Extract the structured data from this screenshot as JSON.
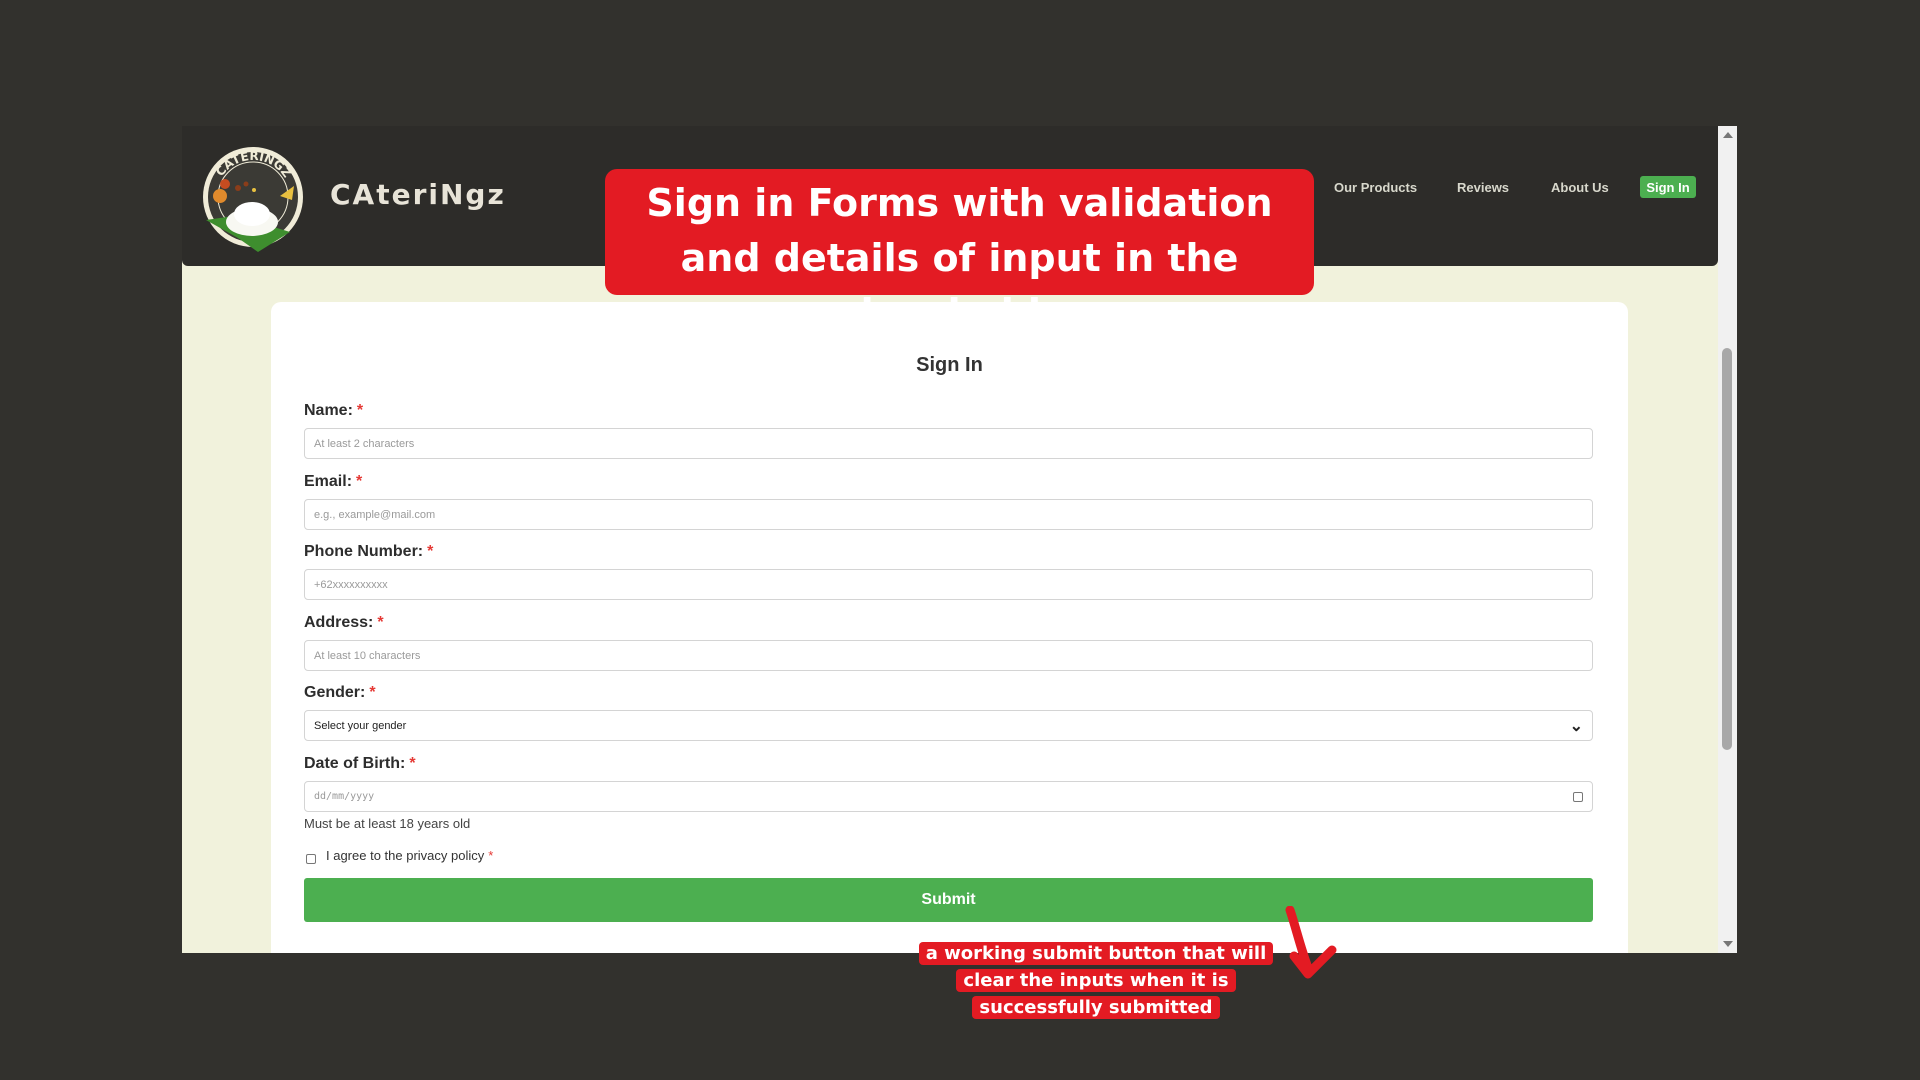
{
  "nav": {
    "brand": "CAteriNgz",
    "logo_text": "CATERINGZ",
    "links": [
      "Our Products",
      "Reviews",
      "About Us"
    ],
    "signin": "Sign In"
  },
  "form": {
    "title": "Sign In",
    "fields": [
      {
        "label": "Name:",
        "placeholder": "At least 2 characters"
      },
      {
        "label": "Email:",
        "placeholder": "e.g., example@mail.com"
      },
      {
        "label": "Phone Number:",
        "placeholder": "+62xxxxxxxxxx"
      },
      {
        "label": "Address:",
        "placeholder": "At least 10 characters"
      },
      {
        "label": "Gender:",
        "selected": "Select your gender"
      },
      {
        "label": "Date of Birth:",
        "placeholder": "dd/mm/yyyy",
        "hint": "Must be at least 18 years old"
      }
    ],
    "required_mark": "*",
    "privacy_label": "I agree to the privacy policy",
    "submit": "Submit"
  },
  "annotations": {
    "title": "Sign in Forms with validation and details of input in the placeholder",
    "note": "a working submit button that will clear the inputs when it is successfully submitted"
  },
  "colors": {
    "accent": "#4caf50",
    "callout": "#e31b23",
    "navbar": "#2d2c29",
    "page_bg": "#f1f2dc"
  }
}
